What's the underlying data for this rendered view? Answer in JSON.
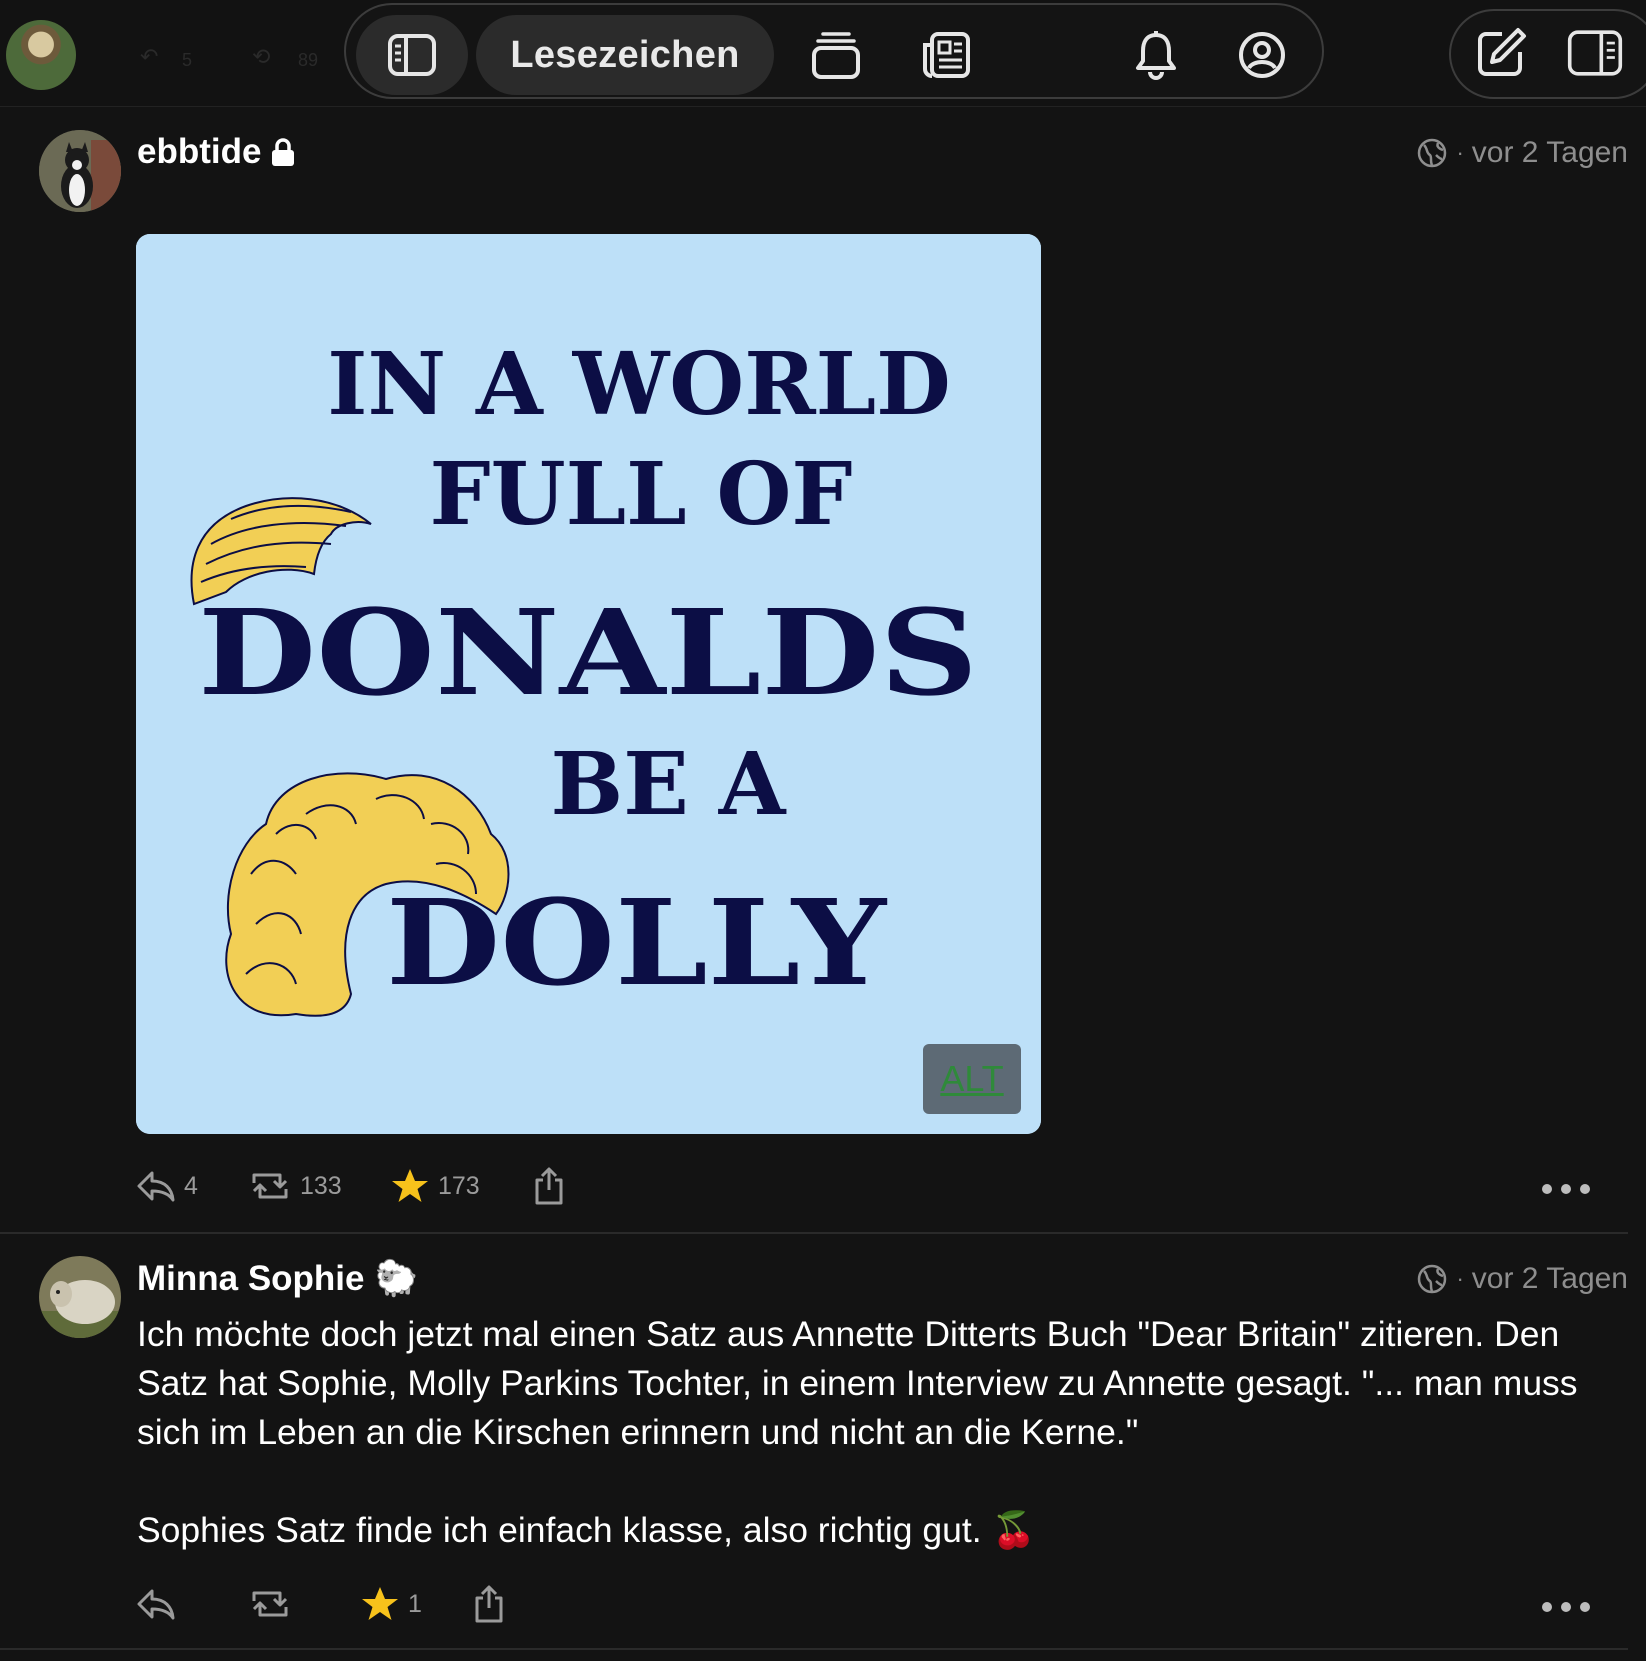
{
  "topbar": {
    "bookmarks_label": "Lesezeichen",
    "faint_reply_count": "5",
    "faint_boost_count": "89"
  },
  "posts": [
    {
      "author": "ebbtide",
      "locked": true,
      "timestamp": "vor 2 Tagen",
      "image": {
        "lines": [
          "IN A WORLD",
          "FULL OF",
          "DONALDS",
          "BE A",
          "DOLLY"
        ],
        "alt_label": "ALT",
        "background_color": "#bde0f8",
        "text_color": "#0c0e45",
        "hair_color": "#f2cf55"
      },
      "stats": {
        "replies": "4",
        "boosts": "133",
        "favourites": "173"
      }
    },
    {
      "author": "Minna Sophie",
      "author_emoji": "🐑",
      "timestamp": "vor 2 Tagen",
      "paragraphs": [
        "Ich möchte doch jetzt mal einen Satz aus Annette Ditterts Buch \"Dear Britain\" zitieren. Den Satz hat Sophie, Molly Parkins Tochter, in einem Interview zu Annette gesagt. \"... man muss sich im Leben an die Kirschen erinnern und nicht an die Kerne.\"",
        "Sophies Satz finde ich einfach klasse, also richtig gut. 🍒"
      ],
      "stats": {
        "favourites": "1"
      }
    }
  ],
  "colors": {
    "background": "#131313",
    "star": "#f7c21b",
    "muted": "#9b9b9b"
  }
}
